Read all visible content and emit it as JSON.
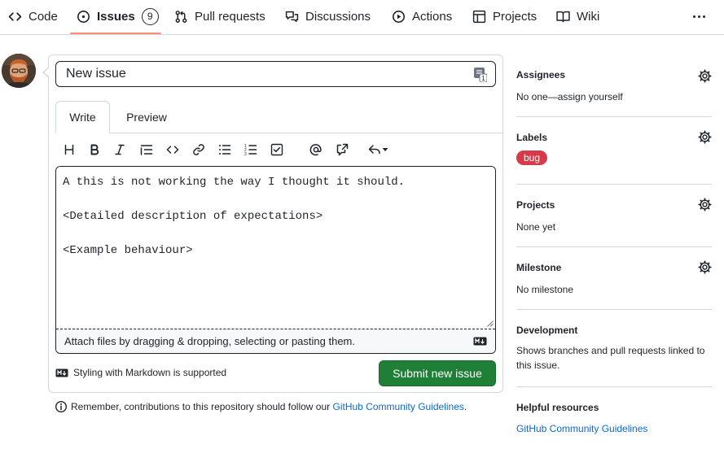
{
  "nav": {
    "items": [
      {
        "label": "Code",
        "icon": "code-icon"
      },
      {
        "label": "Issues",
        "icon": "issue-opened-icon",
        "count": "9"
      },
      {
        "label": "Pull requests",
        "icon": "git-pull-request-icon"
      },
      {
        "label": "Discussions",
        "icon": "comment-discussion-icon"
      },
      {
        "label": "Actions",
        "icon": "play-icon"
      },
      {
        "label": "Projects",
        "icon": "table-icon"
      },
      {
        "label": "Wiki",
        "icon": "book-icon"
      }
    ],
    "active_underline_color": "#fd8c73"
  },
  "form": {
    "title_value": "New issue",
    "tabs": {
      "write": "Write",
      "preview": "Preview"
    },
    "body_text": "A this is not working the way I thought it should.\n\n<Detailed description of expectations>\n\n<Example behaviour>",
    "attach_text": "Attach files by dragging & dropping, selecting or pasting them.",
    "markdown_note": "Styling with Markdown is supported",
    "submit_label": "Submit new issue",
    "submit_color": "#1f7f37"
  },
  "footer": {
    "remember_text": "Remember, contributions to this repository should follow our ",
    "guidelines_link": "GitHub Community Guidelines",
    "period": "."
  },
  "sidebar": {
    "assignees": {
      "heading": "Assignees",
      "value": "No one—assign yourself"
    },
    "labels": {
      "heading": "Labels",
      "label": "bug",
      "label_color": "#d73a4a"
    },
    "projects": {
      "heading": "Projects",
      "value": "None yet"
    },
    "milestone": {
      "heading": "Milestone",
      "value": "No milestone"
    },
    "development": {
      "heading": "Development",
      "value": "Shows branches and pull requests linked to this issue."
    },
    "helpful": {
      "heading": "Helpful resources",
      "link": "GitHub Community Guidelines"
    }
  }
}
